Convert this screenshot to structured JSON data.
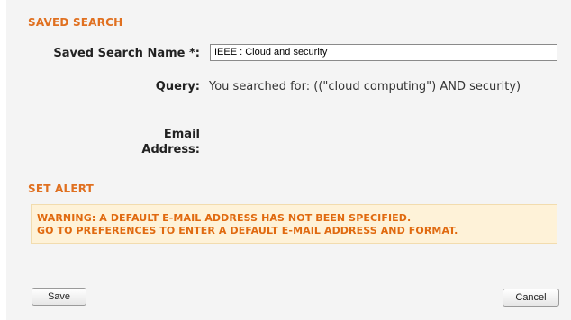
{
  "saved_search": {
    "section_title": "SAVED SEARCH",
    "name_label": "Saved Search Name *:",
    "name_value": "IEEE : Cloud and security",
    "query_label": "Query:",
    "query_value": "You searched for: ((\"cloud computing\") AND security)",
    "email_label": "Email Address:"
  },
  "set_alert": {
    "section_title": "SET ALERT",
    "warning_line1": "WARNING: A DEFAULT E-MAIL ADDRESS HAS NOT BEEN SPECIFIED.",
    "warning_line2": "GO TO PREFERENCES TO ENTER A DEFAULT E-MAIL ADDRESS AND FORMAT."
  },
  "buttons": {
    "save_label": "Save",
    "cancel_label": "Cancel"
  },
  "colors": {
    "accent": "#e07020",
    "warning_bg": "#fef2d8",
    "panel_bg": "#f4f4f4"
  }
}
